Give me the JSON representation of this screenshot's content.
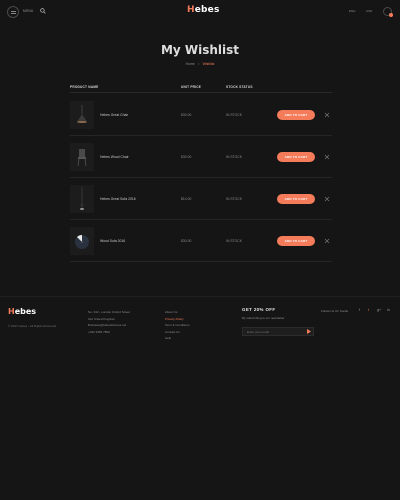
{
  "header": {
    "menu_label": "MENU",
    "logo_initial": "H",
    "logo_rest": "ebes",
    "language": "ENG",
    "currency": "USD"
  },
  "page": {
    "title": "My Wishlist",
    "breadcrumb": [
      "Home",
      "Wishlist"
    ]
  },
  "table": {
    "headers": [
      "PRODUCT NAME",
      "UNIT PRICE",
      "STOCK STATUS"
    ],
    "rows": [
      {
        "name": "Hebes Great Chair",
        "price": "$30.00",
        "stock": "IN STOCK",
        "button": "ADD TO CART",
        "thumb": "pendant-lamp-icon"
      },
      {
        "name": "Hebes Wood Chair",
        "price": "$30.00",
        "stock": "IN STOCK",
        "button": "ADD TO CART",
        "thumb": "chair-icon"
      },
      {
        "name": "Hebes Great Sofa 2016",
        "price": "$14.00",
        "stock": "IN STOCK",
        "button": "ADD TO CART",
        "thumb": "hanging-lamp-icon"
      },
      {
        "name": "Wood Sofa 2016",
        "price": "$30.00",
        "stock": "IN STOCK",
        "button": "ADD TO CART",
        "thumb": "disc-decor-icon"
      }
    ]
  },
  "footer": {
    "logo_initial": "H",
    "logo_rest": "ebes",
    "copyright": "© 2017 Hebes - All Rights Reserved",
    "contact": [
      "No. 342 - London Oxford Street",
      "012 United Kingdom",
      "Business@hebesthemes.net",
      "+032 3456 7890"
    ],
    "links": [
      "About Us",
      "Privacy Policy",
      "Term & Conditions",
      "Contact Us",
      "Help"
    ],
    "highlighted_link": "Privacy Policy",
    "newsletter_heading": "GET 20% OFF",
    "newsletter_sub": "By subscribing to our newsletter",
    "email_placeholder": "Enter your email",
    "follow_label": "Follow Us On Social",
    "social": [
      "f",
      "t",
      "g+",
      "in"
    ]
  },
  "colors": {
    "accent": "#f47c5b",
    "background": "#151515"
  }
}
